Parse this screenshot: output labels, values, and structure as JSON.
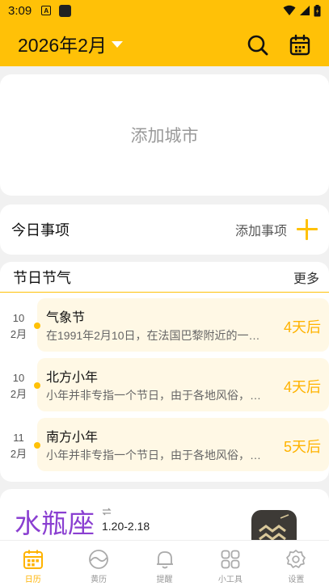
{
  "status_bar": {
    "time": "3:09",
    "badge": "A",
    "icons": [
      "app-square-icon",
      "wifi-icon",
      "signal-icon",
      "battery-icon"
    ]
  },
  "header": {
    "title": "2026年2月",
    "icons": [
      "search-icon",
      "calendar-icon"
    ],
    "accent_color": "#ffc107"
  },
  "city_card": {
    "label": "添加城市"
  },
  "today_card": {
    "title": "今日事项",
    "add_label": "添加事项"
  },
  "festivals": {
    "title": "节日节气",
    "more_label": "更多",
    "items": [
      {
        "day": "10",
        "month": "2月",
        "name": "气象节",
        "desc": "在1991年2月10日，在法国巴黎附近的一…",
        "days_left": "4天后"
      },
      {
        "day": "10",
        "month": "2月",
        "name": "北方小年",
        "desc": "小年并非专指一个节日，由于各地风俗，…",
        "days_left": "4天后"
      },
      {
        "day": "11",
        "month": "2月",
        "name": "南方小年",
        "desc": "小年并非专指一个节日，由于各地风俗，…",
        "days_left": "5天后"
      }
    ]
  },
  "zodiac": {
    "name": "水瓶座",
    "range": "1.20-2.18",
    "name_color": "#8a3fd1"
  },
  "bottom_nav": {
    "items": [
      {
        "label": "日历",
        "icon": "calendar-icon",
        "active": true
      },
      {
        "label": "黄历",
        "icon": "yin-yang-icon",
        "active": false
      },
      {
        "label": "提醒",
        "icon": "bell-icon",
        "active": false
      },
      {
        "label": "小工具",
        "icon": "grid-icon",
        "active": false
      },
      {
        "label": "设置",
        "icon": "gear-icon",
        "active": false
      }
    ]
  }
}
